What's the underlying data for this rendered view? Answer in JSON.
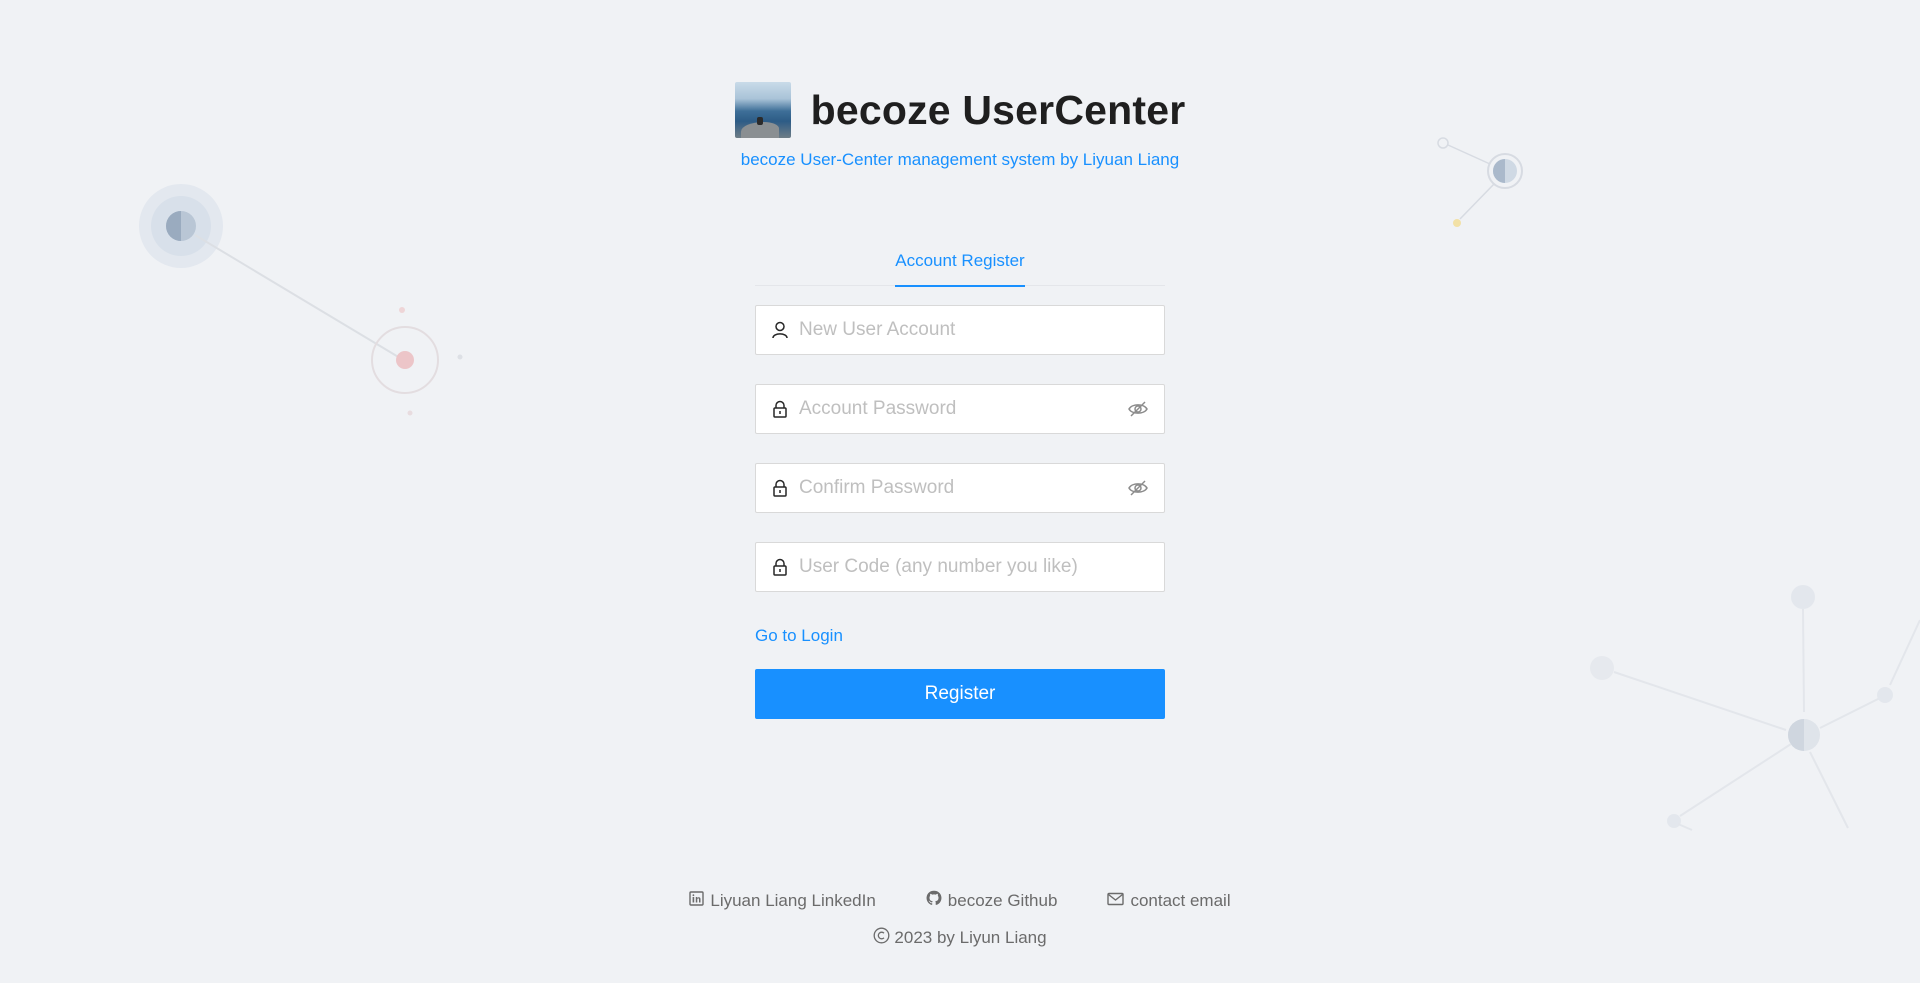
{
  "header": {
    "title": "becoze UserCenter",
    "subtitle": "becoze User-Center management system by Liyuan Liang"
  },
  "tabs": {
    "active_label": "Account Register"
  },
  "form": {
    "account": {
      "placeholder": "New User Account",
      "icon": "user-icon"
    },
    "password": {
      "placeholder": "Account Password",
      "icon": "lock-icon",
      "toggle_icon": "eye-invisible-icon"
    },
    "confirm_password": {
      "placeholder": "Confirm Password",
      "icon": "lock-icon",
      "toggle_icon": "eye-invisible-icon"
    },
    "user_code": {
      "placeholder": "User Code (any number you like)",
      "icon": "lock-icon"
    },
    "login_link": "Go to Login",
    "submit_label": "Register"
  },
  "footer": {
    "links": [
      {
        "label": "Liyuan Liang LinkedIn",
        "icon": "linkedin-icon"
      },
      {
        "label": "becoze Github",
        "icon": "github-icon"
      },
      {
        "label": "contact email",
        "icon": "mail-icon"
      }
    ],
    "copyright": "2023 by Liyun Liang"
  },
  "colors": {
    "primary": "#1890ff",
    "background": "#f0f2f5"
  }
}
